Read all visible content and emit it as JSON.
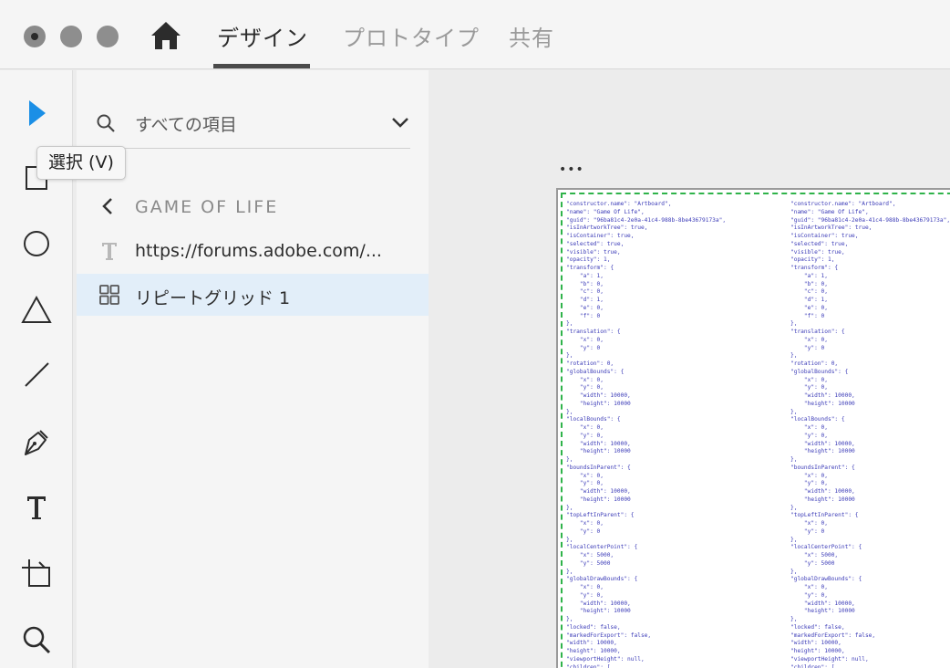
{
  "top_bar": {
    "window_controls": [
      "close-button",
      "minimize-button",
      "zoom-button"
    ],
    "home_icon": "home-icon",
    "tabs": [
      {
        "label": "デザイン",
        "active": true
      },
      {
        "label": "プロトタイプ",
        "active": false
      },
      {
        "label": "共有",
        "active": false
      }
    ]
  },
  "toolbar": {
    "tools": [
      {
        "name": "select-tool",
        "icon": "arrow-icon",
        "active": true
      },
      {
        "name": "rectangle-tool",
        "icon": "rectangle-icon"
      },
      {
        "name": "ellipse-tool",
        "icon": "ellipse-icon"
      },
      {
        "name": "polygon-tool",
        "icon": "triangle-icon"
      },
      {
        "name": "line-tool",
        "icon": "line-icon"
      },
      {
        "name": "pen-tool",
        "icon": "pen-icon"
      },
      {
        "name": "text-tool",
        "icon": "text-icon"
      },
      {
        "name": "artboard-tool",
        "icon": "artboard-icon"
      },
      {
        "name": "zoom-tool",
        "icon": "magnifier-icon"
      }
    ],
    "tooltip": "選択 (V)",
    "accent_color": "#1b8fe6"
  },
  "layers": {
    "search_label": "すべての項目",
    "group_title": "GAME OF LIFE",
    "items": [
      {
        "label": "https://forums.adobe.com/...",
        "icon": "text-layer-icon",
        "selected": false
      },
      {
        "label": "リピートグリッド 1",
        "icon": "repeat-grid-icon",
        "selected": true
      }
    ],
    "selected_color": "#e2eef9"
  },
  "canvas": {
    "artboard_menu": "•••",
    "selection_color": "#2fb34a",
    "code_left": "\"constructor.name\": \"Artboard\",\n\"name\": \"Game Of Life\",\n\"guid\": \"96ba81c4-2e0a-41c4-988b-8be43679173a\",\n\"isInArtworkTree\": true,\n\"isContainer\": true,\n\"selected\": true,\n\"visible\": true,\n\"opacity\": 1,\n\"transform\": {\n    \"a\": 1,\n    \"b\": 0,\n    \"c\": 0,\n    \"d\": 1,\n    \"e\": 0,\n    \"f\": 0\n},\n\"translation\": {\n    \"x\": 0,\n    \"y\": 0\n},\n\"rotation\": 0,\n\"globalBounds\": {\n    \"x\": 0,\n    \"y\": 0,\n    \"width\": 10000,\n    \"height\": 10000\n},\n\"localBounds\": {\n    \"x\": 0,\n    \"y\": 0,\n    \"width\": 10000,\n    \"height\": 10000\n},\n\"boundsInParent\": {\n    \"x\": 0,\n    \"y\": 0,\n    \"width\": 10000,\n    \"height\": 10000\n},\n\"topLeftInParent\": {\n    \"x\": 0,\n    \"y\": 0\n},\n\"localCenterPoint\": {\n    \"x\": 5000,\n    \"y\": 5000\n},\n\"globalDrawBounds\": {\n    \"x\": 0,\n    \"y\": 0,\n    \"width\": 10000,\n    \"height\": 10000\n},\n\"locked\": false,\n\"markedForExport\": false,\n\"width\": 10000,\n\"height\": 10000,\n\"viewportHeight\": null,\n\"children\": [",
    "code_right": "\"constructor.name\": \"Artboard\",\n\"name\": \"Game Of Life\",\n\"guid\": \"96ba81c4-2e0a-41c4-988b-8be43679173a\",\n\"isInArtworkTree\": true,\n\"isContainer\": true,\n\"selected\": true,\n\"visible\": true,\n\"opacity\": 1,\n\"transform\": {\n    \"a\": 1,\n    \"b\": 0,\n    \"c\": 0,\n    \"d\": 1,\n    \"e\": 0,\n    \"f\": 0\n},\n\"translation\": {\n    \"x\": 0,\n    \"y\": 0\n},\n\"rotation\": 0,\n\"globalBounds\": {\n    \"x\": 0,\n    \"y\": 0,\n    \"width\": 10000,\n    \"height\": 10000\n},\n\"localBounds\": {\n    \"x\": 0,\n    \"y\": 0,\n    \"width\": 10000,\n    \"height\": 10000\n},\n\"boundsInParent\": {\n    \"x\": 0,\n    \"y\": 0,\n    \"width\": 10000,\n    \"height\": 10000\n},\n\"topLeftInParent\": {\n    \"x\": 0,\n    \"y\": 0\n},\n\"localCenterPoint\": {\n    \"x\": 5000,\n    \"y\": 5000\n},\n\"globalDrawBounds\": {\n    \"x\": 0,\n    \"y\": 0,\n    \"width\": 10000,\n    \"height\": 10000\n},\n\"locked\": false,\n\"markedForExport\": false,\n\"width\": 10000,\n\"height\": 10000,\n\"viewportHeight\": null,\n\"children\": ["
  }
}
